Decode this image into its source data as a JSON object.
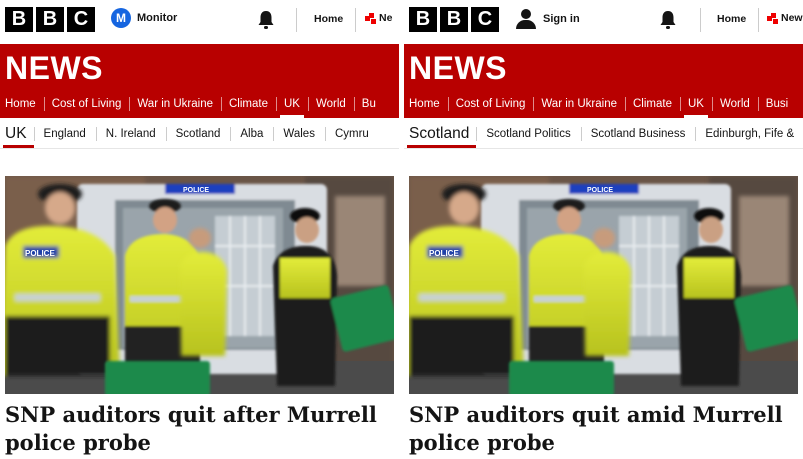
{
  "panels": [
    {
      "brand": [
        "B",
        "B",
        "C"
      ],
      "account": {
        "avatar_letter": "M",
        "label": "Monitor"
      },
      "home_label": "Home",
      "news_label": "Ne",
      "masthead": "NEWS",
      "nav": [
        "Home",
        "Cost of Living",
        "War in Ukraine",
        "Climate",
        "UK",
        "World",
        "Bu"
      ],
      "nav_active": "UK",
      "section": "UK",
      "subnav": [
        "England",
        "N. Ireland",
        "Scotland",
        "Alba",
        "Wales",
        "Cymru"
      ],
      "headline": "SNP auditors quit after Murrell police probe"
    },
    {
      "brand": [
        "B",
        "B",
        "C"
      ],
      "account": {
        "label": "Sign in"
      },
      "home_label": "Home",
      "news_label": "News",
      "masthead": "NEWS",
      "nav": [
        "Home",
        "Cost of Living",
        "War in Ukraine",
        "Climate",
        "UK",
        "World",
        "Busi"
      ],
      "nav_active": "UK",
      "section": "Scotland",
      "subnav": [
        "Scotland Politics",
        "Scotland Business",
        "Edinburgh, Fife &"
      ],
      "headline": "SNP auditors quit amid Murrell police probe"
    }
  ],
  "image_text": {
    "van_label": "POLICE",
    "vest_label": "POLICE"
  },
  "colors": {
    "bbc_red": "#b80000",
    "account_blue": "#1565e0",
    "hi_vis": "#d6e22a",
    "bin_green": "#1f8a4c"
  },
  "icons": {
    "bell": "bell-icon",
    "account": "account-icon",
    "news_mark": "bbc-news-mark-icon"
  }
}
